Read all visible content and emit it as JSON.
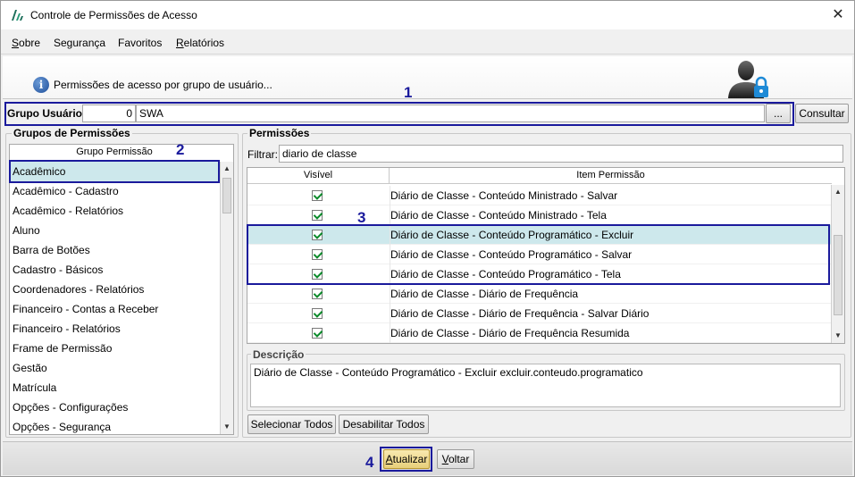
{
  "window": {
    "title": "Controle de Permissões de Acesso"
  },
  "menu": [
    {
      "label": "Sobre"
    },
    {
      "label": "Segurança"
    },
    {
      "label": "Favoritos"
    },
    {
      "label": "Relatórios"
    }
  ],
  "header": {
    "text": "Permissões de acesso por grupo de usuário..."
  },
  "user_group": {
    "label": "Grupo Usuário:",
    "code": "0",
    "name": "SWA",
    "browse_label": "...",
    "consult_label": "Consultar"
  },
  "groups_panel": {
    "title": "Grupos de Permissões",
    "column_header": "Grupo Permissão",
    "items": [
      "Acadêmico",
      "Acadêmico - Cadastro",
      "Acadêmico - Relatórios",
      "Aluno",
      "Barra de Botões",
      "Cadastro - Básicos",
      "Coordenadores - Relatórios",
      "Financeiro - Contas a Receber",
      "Financeiro - Relatórios",
      "Frame de Permissão",
      "Gestão",
      "Matrícula",
      "Opções - Configurações",
      "Opções - Segurança"
    ],
    "selected_index": 0
  },
  "permissions_panel": {
    "title": "Permissões",
    "filter_label": "Filtrar:",
    "filter_value": "diario de classe",
    "columns": [
      "Visível",
      "Item Permissão"
    ],
    "rows": [
      {
        "visible": true,
        "item": "Diário de Classe - Conteúdo Ministrado - Salvar"
      },
      {
        "visible": true,
        "item": "Diário de Classe - Conteúdo Ministrado - Tela"
      },
      {
        "visible": true,
        "item": "Diário de Classe - Conteúdo Programático - Excluir"
      },
      {
        "visible": true,
        "item": "Diário de Classe - Conteúdo Programático - Salvar"
      },
      {
        "visible": true,
        "item": "Diário de Classe - Conteúdo Programático - Tela"
      },
      {
        "visible": true,
        "item": "Diário de Classe - Diário de Frequência"
      },
      {
        "visible": true,
        "item": "Diário de Classe - Diário de Frequência - Salvar Diário"
      },
      {
        "visible": true,
        "item": "Diário de Classe - Diário de Frequência Resumida"
      }
    ],
    "selected_index": 2,
    "description_title": "Descrição",
    "description_text": "Diário de Classe - Conteúdo Programático - Excluir excluir.conteudo.programatico",
    "select_all_label": "Selecionar Todos",
    "disable_all_label": "Desabilitar Todos"
  },
  "footer": {
    "update_label": "Atualizar",
    "back_label": "Voltar"
  },
  "annotations": [
    "1",
    "2",
    "3",
    "4"
  ],
  "colors": {
    "annotation": "#1a1a9c",
    "selection": "#cde8ec",
    "check": "#0a8a2a"
  }
}
